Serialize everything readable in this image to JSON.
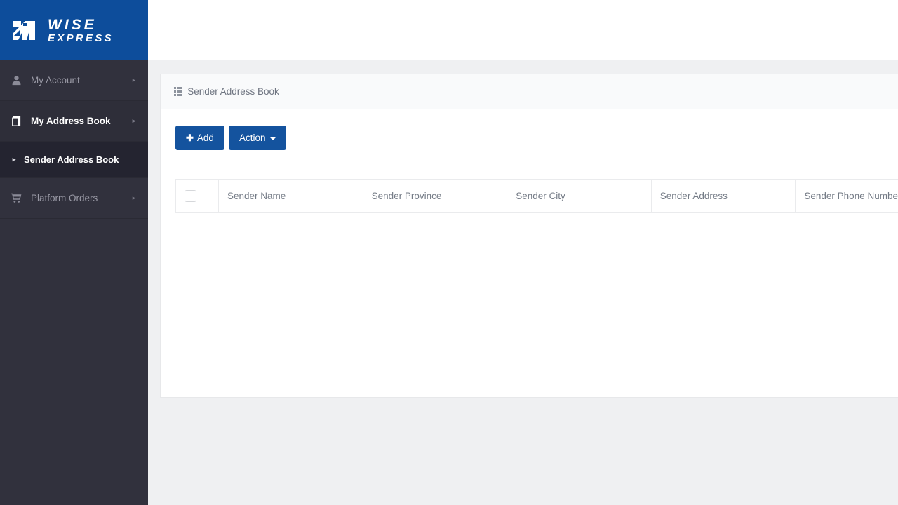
{
  "brand": {
    "line1": "WISE",
    "line2": "EXPRESS",
    "logo_icon": "wise-express-logo-icon",
    "background_color": "#0d4d9b"
  },
  "sidebar": {
    "background_color": "#31313d",
    "active_background_color": "#242430",
    "items": [
      {
        "label": "My Account",
        "icon": "user-icon",
        "caret": "▸",
        "state": "default"
      },
      {
        "label": "My Address Book",
        "icon": "book-icon",
        "caret": "▸",
        "state": "expanded"
      },
      {
        "label": "Sender Address Book",
        "icon": "bullet-arrow-icon",
        "caret": "",
        "state": "active"
      },
      {
        "label": "Platform Orders",
        "icon": "cart-icon",
        "caret": "▸",
        "state": "default"
      }
    ]
  },
  "panel": {
    "heading_icon": "grid-icon",
    "heading_title": "Sender Address Book"
  },
  "toolbar": {
    "add_label": "Add",
    "add_icon": "plus-icon",
    "action_label": "Action",
    "action_caret_icon": "chevron-down-icon",
    "button_color": "#14539e"
  },
  "table": {
    "select_all_checkbox": "unchecked",
    "columns": [
      "Sender Name",
      "Sender Province",
      "Sender City",
      "Sender Address",
      "Sender Phone Number"
    ],
    "rows": []
  }
}
